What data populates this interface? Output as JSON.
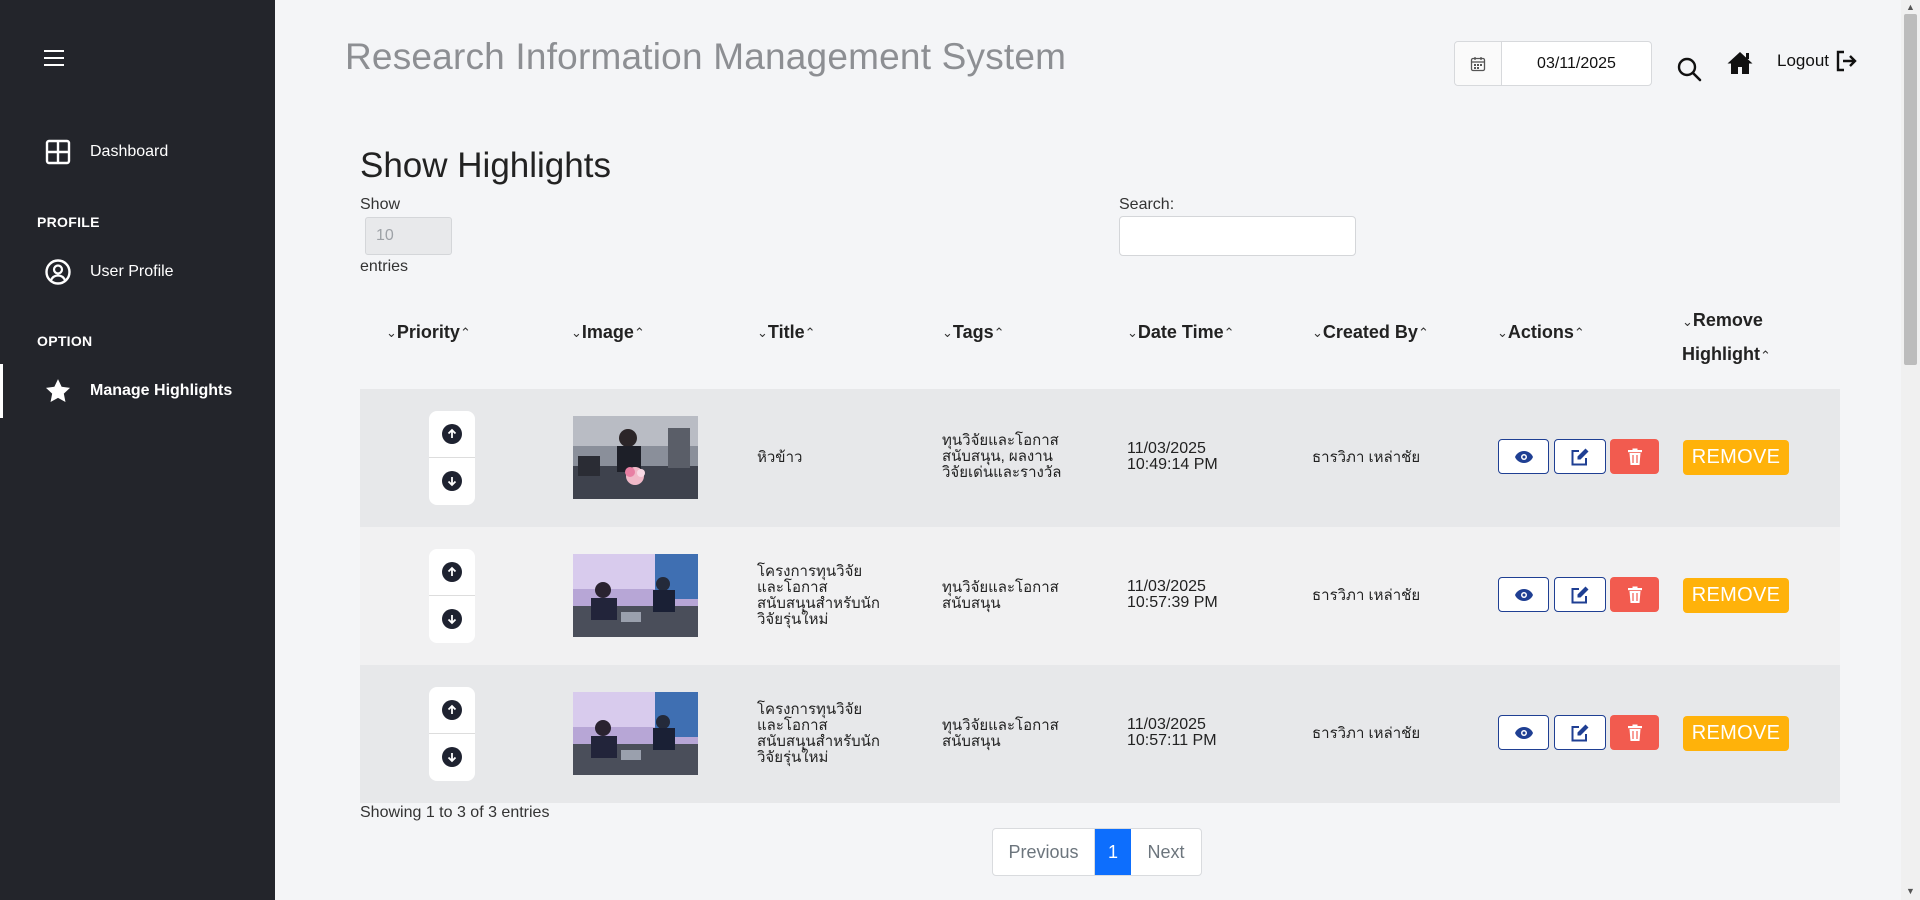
{
  "sidebar": {
    "items": [
      {
        "label": "Dashboard",
        "icon": "grid-icon"
      },
      {
        "label": "User Profile",
        "icon": "user-circle-icon"
      },
      {
        "label": "Manage Highlights",
        "icon": "star-icon"
      }
    ],
    "sections": {
      "profile": "PROFILE",
      "option": "OPTION"
    }
  },
  "header": {
    "title": "Research Information Management System",
    "date": "03/11/2025",
    "logout": "Logout"
  },
  "main": {
    "page_title": "Show Highlights",
    "show_label": "Show",
    "entries_value": "10",
    "entries_label": "entries",
    "search_label": "Search:",
    "columns": [
      "Priority",
      "Image",
      "Title",
      "Tags",
      "Date Time",
      "Created By",
      "Actions",
      "Remove",
      "Highlight"
    ],
    "rows": [
      {
        "title": [
          "หิวข้าว"
        ],
        "tags": [
          "ทุนวิจัยและโอกาส",
          "สนับสนุน, ผลงาน",
          "วิจัยเด่นและรางวัล"
        ],
        "date": "11/03/2025",
        "time": "10:49:14 PM",
        "created_by": "ธารวิภา เหล่าชัย",
        "remove": "REMOVE"
      },
      {
        "title": [
          "โครงการทุนวิจัย",
          "และโอกาส",
          "สนับสนุนสำหรับนัก",
          "วิจัยรุ่นใหม่"
        ],
        "tags": [
          "ทุนวิจัยและโอกาส",
          "สนับสนุน"
        ],
        "date": "11/03/2025",
        "time": "10:57:39 PM",
        "created_by": "ธารวิภา เหล่าชัย",
        "remove": "REMOVE"
      },
      {
        "title": [
          "โครงการทุนวิจัย",
          "และโอกาส",
          "สนับสนุนสำหรับนัก",
          "วิจัยรุ่นใหม่"
        ],
        "tags": [
          "ทุนวิจัยและโอกาส",
          "สนับสนุน"
        ],
        "date": "11/03/2025",
        "time": "10:57:11 PM",
        "created_by": "ธารวิภา เหล่าชัย",
        "remove": "REMOVE"
      }
    ],
    "summary": "Showing 1 to 3 of 3 entries",
    "pagination": {
      "previous": "Previous",
      "current": "1",
      "next": "Next"
    }
  },
  "colors": {
    "sidebar": "#23252b",
    "remove": "#ffb20a",
    "delete": "#f25b4f",
    "primary": "#0d6efd",
    "action_border": "#1f3f93"
  }
}
